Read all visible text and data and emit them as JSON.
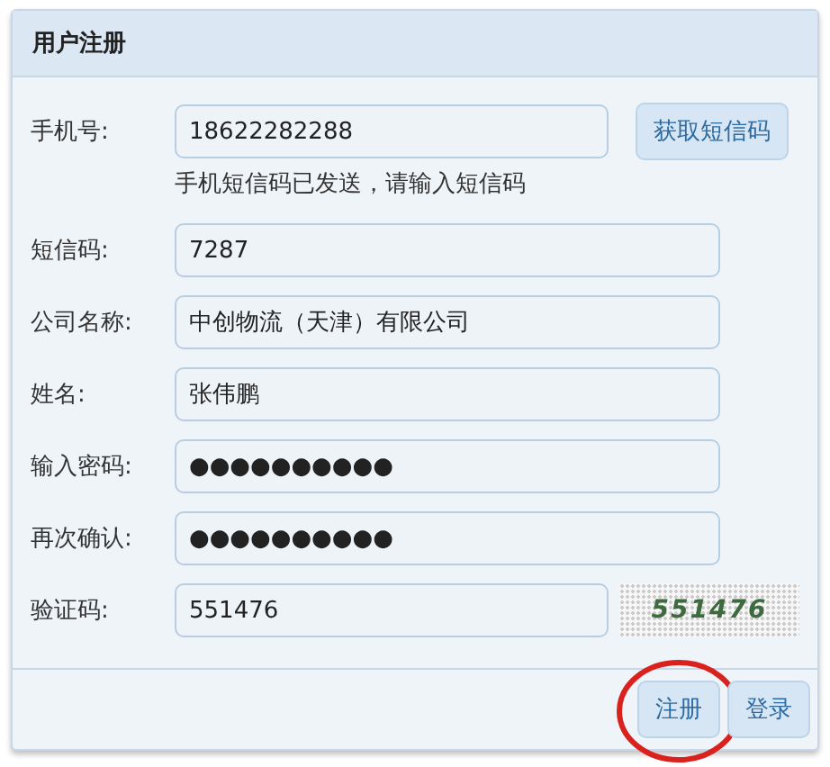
{
  "panel": {
    "title": "用户注册"
  },
  "fields": [
    {
      "label": "手机号:",
      "value": "18622282288",
      "button": "获取短信码",
      "hint": "手机短信码已发送，请输入短信码"
    },
    {
      "label": "短信码:",
      "value": "7287"
    },
    {
      "label": "公司名称:",
      "value": "中创物流（天津）有限公司"
    },
    {
      "label": "姓名:",
      "value": "张伟鹏"
    },
    {
      "label": "输入密码:",
      "value": "●●●●●●●●●●"
    },
    {
      "label": "再次确认:",
      "value": "●●●●●●●●●●"
    },
    {
      "label": "验证码:",
      "value": "551476",
      "captcha": "551476"
    }
  ],
  "buttons": [
    {
      "label": "注册",
      "circled": true
    },
    {
      "label": "登录",
      "circled": false
    }
  ]
}
